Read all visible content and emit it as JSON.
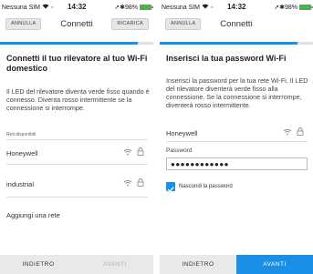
{
  "colors": {
    "accent": "#1b8ee6",
    "battery": "#3cc13c"
  },
  "status_bar": {
    "carrier": "Nessuna SIM",
    "time": "14:32",
    "battery": "98%"
  },
  "left": {
    "nav": {
      "cancel": "ANNULLA",
      "title": "Connetti",
      "reload": "RICARICA"
    },
    "progress": 0.9,
    "heading": "Connetti il tuo rilevatore al tuo Wi-Fi domestico",
    "description": "Il LED del rilevatore diventa verde fisso quando è connesso. Diventa rosso intermittente se la connessione si interrompe.",
    "networks_label": "Reti disponibili",
    "networks": [
      {
        "name": "Honeywell",
        "icons": [
          "wifi-icon",
          "lock-icon"
        ]
      },
      {
        "name": "industrial",
        "icons": [
          "wifi-icon",
          "lock-icon"
        ]
      }
    ],
    "add_network": "Aggiungi una rete",
    "back": "INDIETRO",
    "next": "AVANTI"
  },
  "right": {
    "nav": {
      "cancel": "ANNULLA",
      "title": "Connetti"
    },
    "progress": 0.9,
    "heading": "Inserisci la tua password Wi-Fi",
    "description": "Inserisci la password per la tua rete Wi-Fi. Il LED del rilevatore diventerà verde fisso alla connessione. Se la connessione si interrompe, diventerà rosso intermittente.",
    "network": {
      "name": "Honeywell",
      "icons": [
        "wifi-icon",
        "lock-icon"
      ]
    },
    "password_label": "Password",
    "password_value": "●●●●●●●●●●●●",
    "hide_password": {
      "label": "Nascondi la password",
      "checked": true
    },
    "back": "INDIETRO",
    "next": "AVANTI"
  }
}
